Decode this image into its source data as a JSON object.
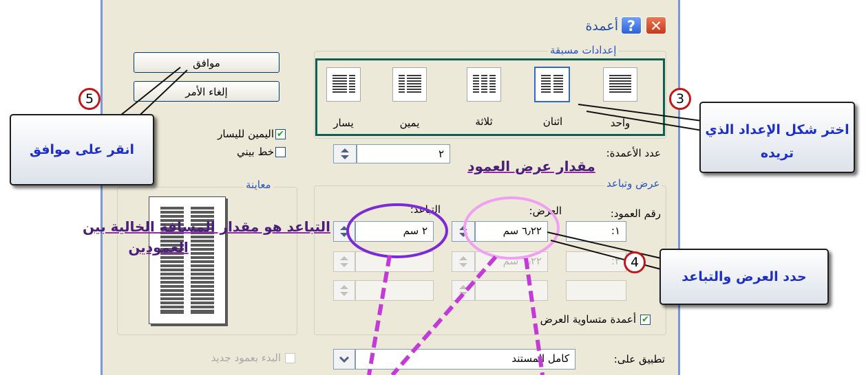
{
  "dialog": {
    "title": "أعمدة",
    "help_button": "?",
    "close_button": "✕"
  },
  "presets": {
    "group_label": "إعدادات مسبقة",
    "items": [
      {
        "label": "واحد",
        "columns": 1,
        "selected": false
      },
      {
        "label": "اثنان",
        "columns": 2,
        "selected": true
      },
      {
        "label": "ثلاثة",
        "columns": 3,
        "selected": false
      },
      {
        "label": "يمين",
        "columns": 2,
        "selected": false
      },
      {
        "label": "يسار",
        "columns": 2,
        "selected": false
      }
    ]
  },
  "buttons": {
    "ok": "موافق",
    "cancel": "إلغاء الأمر"
  },
  "options": {
    "rtl_label": "اليمين لليسار",
    "rtl_checked": true,
    "line_between_label": "خط بيني",
    "line_between_checked": false,
    "start_new_column_label": "البدء بعمود جديد",
    "equal_width_label": "أعمدة متساوية العرض",
    "equal_width_checked": true
  },
  "num_columns": {
    "label": "عدد الأعمدة:",
    "value": "٢"
  },
  "width_spacing": {
    "group_label": "عرض وتباعد",
    "col_number_header": "رقم العمود:",
    "width_header": "العرض:",
    "spacing_header": "التباعد:",
    "rows": [
      {
        "col": "١:",
        "width": "٦٫٢٢ سم",
        "spacing": "٢ سم",
        "enabled": true
      },
      {
        "col": "٢:",
        "width": "٦٫٢٢ سم",
        "spacing": "",
        "enabled": false
      },
      {
        "col": "",
        "width": "",
        "spacing": "",
        "enabled": false
      }
    ]
  },
  "preview": {
    "group_label": "معاينة"
  },
  "apply_to": {
    "label": "تطبيق على:",
    "value": "كامل المستند"
  },
  "annotations": {
    "callout_choose": "اختر شكل الإعداد الذي تريده",
    "callout_ok": "انقر على موافق",
    "callout_width": "حدد العرض والتباعد",
    "badge_3": "3",
    "badge_4": "4",
    "badge_5": "5",
    "note_width": "مقدار عرض العمود",
    "note_spacing_1": "التباعد هو مقدار المسافة الخالية  بين",
    "note_spacing_2": "العمودين"
  },
  "colors": {
    "dialog_bg": "#ece9d8",
    "title_blue": "#224aa8",
    "selected_border": "#316ac5",
    "preset_frame": "#0e5e52",
    "callout_text": "#1e2fc8",
    "badge_ring": "#c01818",
    "circle_spacing": "#7a2ad6",
    "circle_width": "#f0a0f0",
    "dash_line": "#c33ad6",
    "check_green": "#21a121"
  }
}
